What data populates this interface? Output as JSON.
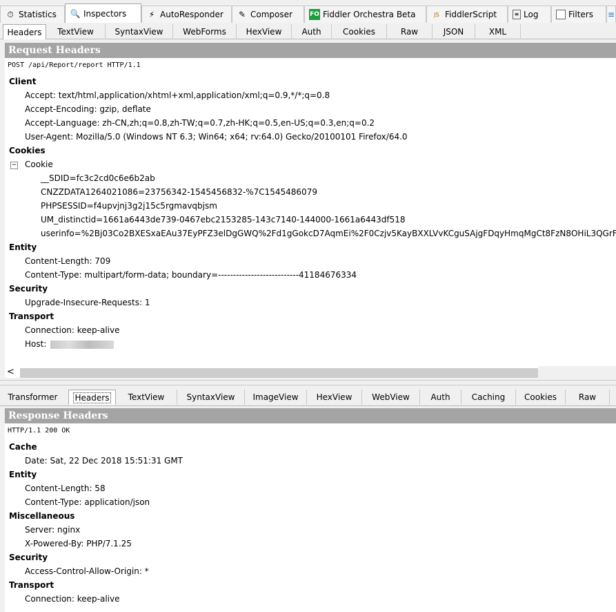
{
  "top_tabs": [
    {
      "label": "Statistics",
      "icon": "statistics-icon",
      "glyph": "⏱"
    },
    {
      "label": "Inspectors",
      "icon": "inspectors-icon",
      "glyph": "🔍"
    },
    {
      "label": "AutoResponder",
      "icon": "autoresponder-icon",
      "glyph": "⚡"
    },
    {
      "label": "Composer",
      "icon": "composer-icon",
      "glyph": "✎"
    },
    {
      "label": "Fiddler Orchestra Beta",
      "icon": "fiddler-orchestra-icon",
      "glyph": "FO"
    },
    {
      "label": "FiddlerScript",
      "icon": "fiddlerscript-icon",
      "glyph": "JS"
    },
    {
      "label": "Log",
      "icon": "log-icon",
      "glyph": "≡"
    },
    {
      "label": "Filters",
      "icon": "filters-checkbox-icon",
      "glyph": ""
    }
  ],
  "request_tabs": [
    "Headers",
    "TextView",
    "SyntaxView",
    "WebForms",
    "HexView",
    "Auth",
    "Cookies",
    "Raw",
    "JSON",
    "XML"
  ],
  "request": {
    "section_title": "Request Headers",
    "request_line": "POST /api/Report/report HTTP/1.1",
    "groups": {
      "client": "Client",
      "cookies": "Cookies",
      "entity": "Entity",
      "security": "Security",
      "transport": "Transport"
    },
    "client": [
      "Accept: text/html,application/xhtml+xml,application/xml;q=0.9,*/*;q=0.8",
      "Accept-Encoding: gzip, deflate",
      "Accept-Language: zh-CN,zh;q=0.8,zh-TW;q=0.7,zh-HK;q=0.5,en-US;q=0.3,en;q=0.2",
      "User-Agent: Mozilla/5.0 (Windows NT 6.3; Win64; x64; rv:64.0) Gecko/20100101 Firefox/64.0"
    ],
    "cookie_label": "Cookie",
    "cookie_toggle": "−",
    "cookies": [
      "__SDID=fc3c2cd0c6e6b2ab",
      "CNZZDATA1264021086=23756342-1545456832-%7C1545486079",
      "PHPSESSID=f4upvjnj3g2j15c5rgmavqbjsm",
      "UM_distinctid=1661a6443de739-0467ebc2153285-143c7140-144000-1661a6443df518",
      "userinfo=%2Bj03Co2BXESxaEAu37EyPFZ3elDgGWQ%2Fd1gGokcD7AqmEi%2F0Czjv5KayBXXLVvKCguSAjgFDqyHmqMgCt8FzN8OHiL3QGrF"
    ],
    "entity": [
      "Content-Length: 709",
      "Content-Type: multipart/form-data; boundary=---------------------------41184676334"
    ],
    "security": [
      "Upgrade-Insecure-Requests: 1"
    ],
    "transport": [
      "Connection: keep-alive"
    ],
    "host_label": "Host:"
  },
  "scroll_left": "<",
  "response_tabs": [
    "Transformer",
    "Headers",
    "TextView",
    "SyntaxView",
    "ImageView",
    "HexView",
    "WebView",
    "Auth",
    "Caching",
    "Cookies",
    "Raw"
  ],
  "response": {
    "section_title": "Response Headers",
    "status_line": "HTTP/1.1 200 OK",
    "groups": {
      "cache": "Cache",
      "entity": "Entity",
      "misc": "Miscellaneous",
      "security": "Security",
      "transport": "Transport"
    },
    "cache": [
      "Date: Sat, 22 Dec 2018 15:51:31 GMT"
    ],
    "entity": [
      "Content-Length: 58",
      "Content-Type: application/json"
    ],
    "misc": [
      "Server: nginx",
      "X-Powered-By: PHP/7.1.25"
    ],
    "security": [
      "Access-Control-Allow-Origin: *"
    ],
    "transport": [
      "Connection: keep-alive"
    ]
  }
}
